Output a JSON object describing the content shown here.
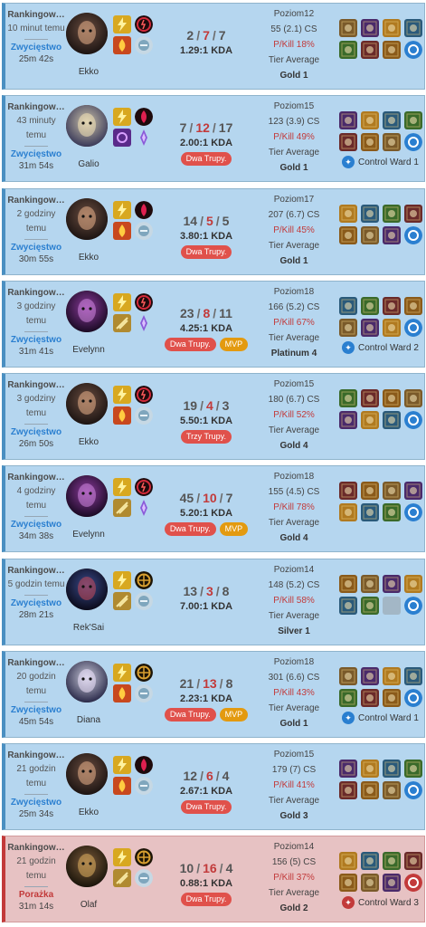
{
  "labels": {
    "queue": "Rankingow…",
    "level_prefix": "Poziom",
    "cs_suffix": "CS",
    "pkill_prefix": "P/Kill",
    "tier_label": "Tier Average",
    "kda_suffix": "KDA"
  },
  "colors": {
    "win_bg": "#b5d6ef",
    "loss_bg": "#e7c2c3",
    "win_text": "#2a7fd0",
    "loss_text": "#c23a3a",
    "deaths": "#c23a3a",
    "multikill_badge": "#e0514b",
    "mvp_badge": "#e39a10"
  },
  "matches": [
    {
      "result": "win",
      "queue": "Rankingow…",
      "time_ago": "10 minut temu",
      "result_label": "Zwycięstwo",
      "duration": "25m 42s",
      "champion": "Ekko",
      "champion_icon": "ekko-portrait",
      "spells": [
        "flash-icon",
        "ignite-icon"
      ],
      "runes": [
        "electrocute-icon",
        "resolve-icon"
      ],
      "kills": "2",
      "deaths": "7",
      "assists": "7",
      "kda": "1.29:1 KDA",
      "badges": [],
      "level": "Poziom12",
      "cs": "55 (2.1) CS",
      "pkill": "P/Kill 18%",
      "tier": "Gold 1",
      "items": [
        "item-a",
        "item-b",
        "item-c",
        "item-d",
        "item-e",
        "item-f",
        "item-g",
        "ward-totem"
      ],
      "control_ward": ""
    },
    {
      "result": "win",
      "queue": "Rankingow…",
      "time_ago": "43 minuty temu",
      "result_label": "Zwycięstwo",
      "duration": "31m 54s",
      "champion": "Galio",
      "champion_icon": "galio-portrait",
      "spells": [
        "flash-icon",
        "teleport-icon"
      ],
      "runes": [
        "conqueror-icon",
        "sorcery-icon"
      ],
      "kills": "7",
      "deaths": "12",
      "assists": "17",
      "kda": "2.00:1 KDA",
      "badges": [
        "Dwa Trupy."
      ],
      "level": "Poziom15",
      "cs": "123 (3.9) CS",
      "pkill": "P/Kill 49%",
      "tier": "Gold 1",
      "items": [
        "item-a",
        "item-b",
        "item-c",
        "item-d",
        "item-e",
        "item-f",
        "item-g",
        "ward-totem"
      ],
      "control_ward": "Control Ward 1"
    },
    {
      "result": "win",
      "queue": "Rankingow…",
      "time_ago": "2 godziny temu",
      "result_label": "Zwycięstwo",
      "duration": "30m 55s",
      "champion": "Ekko",
      "champion_icon": "ekko-portrait",
      "spells": [
        "flash-icon",
        "ignite-icon"
      ],
      "runes": [
        "conqueror-icon",
        "resolve-icon"
      ],
      "kills": "14",
      "deaths": "5",
      "assists": "5",
      "kda": "3.80:1 KDA",
      "badges": [
        "Dwa Trupy."
      ],
      "level": "Poziom17",
      "cs": "207 (6.7) CS",
      "pkill": "P/Kill 45%",
      "tier": "Gold 1",
      "items": [
        "item-a",
        "item-b",
        "item-c",
        "item-d",
        "item-e",
        "item-f",
        "item-g",
        "ward-totem"
      ],
      "control_ward": ""
    },
    {
      "result": "win",
      "queue": "Rankingow…",
      "time_ago": "3 godziny temu",
      "result_label": "Zwycięstwo",
      "duration": "31m 41s",
      "champion": "Evelynn",
      "champion_icon": "evelynn-portrait",
      "spells": [
        "flash-icon",
        "smite-icon"
      ],
      "runes": [
        "electrocute-icon",
        "sorcery-icon"
      ],
      "kills": "23",
      "deaths": "8",
      "assists": "11",
      "kda": "4.25:1 KDA",
      "badges": [
        "Dwa Trupy.",
        "MVP"
      ],
      "level": "Poziom18",
      "cs": "166 (5.2) CS",
      "pkill": "P/Kill 67%",
      "tier": "Platinum 4",
      "items": [
        "item-a",
        "item-b",
        "item-c",
        "item-d",
        "item-e",
        "item-f",
        "item-g",
        "ward-totem"
      ],
      "control_ward": "Control Ward 2"
    },
    {
      "result": "win",
      "queue": "Rankingow…",
      "time_ago": "3 godziny temu",
      "result_label": "Zwycięstwo",
      "duration": "26m 50s",
      "champion": "Ekko",
      "champion_icon": "ekko-portrait",
      "spells": [
        "flash-icon",
        "ignite-icon"
      ],
      "runes": [
        "electrocute-icon",
        "resolve-icon"
      ],
      "kills": "19",
      "deaths": "4",
      "assists": "3",
      "kda": "5.50:1 KDA",
      "badges": [
        "Trzy Trupy."
      ],
      "level": "Poziom15",
      "cs": "180 (6.7) CS",
      "pkill": "P/Kill 52%",
      "tier": "Gold 4",
      "items": [
        "item-a",
        "item-b",
        "item-c",
        "item-d",
        "item-e",
        "item-f",
        "item-g",
        "ward-totem"
      ],
      "control_ward": ""
    },
    {
      "result": "win",
      "queue": "Rankingow…",
      "time_ago": "4 godziny temu",
      "result_label": "Zwycięstwo",
      "duration": "34m 38s",
      "champion": "Evelynn",
      "champion_icon": "evelynn-portrait",
      "spells": [
        "flash-icon",
        "smite-icon"
      ],
      "runes": [
        "electrocute-icon",
        "sorcery-icon"
      ],
      "kills": "45",
      "deaths": "10",
      "assists": "7",
      "kda": "5.20:1 KDA",
      "badges": [
        "Dwa Trupy.",
        "MVP"
      ],
      "level": "Poziom18",
      "cs": "155 (4.5) CS",
      "pkill": "P/Kill 78%",
      "tier": "Gold 4",
      "items": [
        "item-a",
        "item-b",
        "item-c",
        "item-d",
        "item-e",
        "item-f",
        "item-g",
        "ward-totem"
      ],
      "control_ward": ""
    },
    {
      "result": "win",
      "queue": "Rankingow…",
      "time_ago": "5 godzin temu",
      "result_label": "Zwycięstwo",
      "duration": "28m 21s",
      "champion": "Rek'Sai",
      "champion_icon": "reksai-portrait",
      "spells": [
        "flash-icon",
        "smite-icon"
      ],
      "runes": [
        "precision-icon",
        "resolve-icon"
      ],
      "kills": "13",
      "deaths": "3",
      "assists": "8",
      "kda": "7.00:1 KDA",
      "badges": [],
      "level": "Poziom14",
      "cs": "148 (5.2) CS",
      "pkill": "P/Kill 58%",
      "tier": "Silver 1",
      "items": [
        "item-a",
        "item-b",
        "item-c",
        "item-d",
        "item-e",
        "item-f",
        "empty-slot",
        "ward-totem"
      ],
      "control_ward": ""
    },
    {
      "result": "win",
      "queue": "Rankingow…",
      "time_ago": "20 godzin temu",
      "result_label": "Zwycięstwo",
      "duration": "45m 54s",
      "champion": "Diana",
      "champion_icon": "diana-portrait",
      "spells": [
        "flash-icon",
        "ignite-icon"
      ],
      "runes": [
        "precision-icon",
        "resolve-icon"
      ],
      "kills": "21",
      "deaths": "13",
      "assists": "8",
      "kda": "2.23:1 KDA",
      "badges": [
        "Dwa Trupy.",
        "MVP"
      ],
      "level": "Poziom18",
      "cs": "301 (6.6) CS",
      "pkill": "P/Kill 43%",
      "tier": "Gold 1",
      "items": [
        "item-a",
        "item-b",
        "item-c",
        "item-d",
        "item-e",
        "item-f",
        "item-g",
        "ward-totem"
      ],
      "control_ward": "Control Ward 1"
    },
    {
      "result": "win",
      "queue": "Rankingow…",
      "time_ago": "21 godzin temu",
      "result_label": "Zwycięstwo",
      "duration": "25m 34s",
      "champion": "Ekko",
      "champion_icon": "ekko-portrait",
      "spells": [
        "flash-icon",
        "ignite-icon"
      ],
      "runes": [
        "conqueror-icon",
        "resolve-icon"
      ],
      "kills": "12",
      "deaths": "6",
      "assists": "4",
      "kda": "2.67:1 KDA",
      "badges": [
        "Dwa Trupy."
      ],
      "level": "Poziom15",
      "cs": "179 (7) CS",
      "pkill": "P/Kill 41%",
      "tier": "Gold 3",
      "items": [
        "item-a",
        "item-b",
        "item-c",
        "item-d",
        "item-e",
        "item-f",
        "item-g",
        "ward-totem"
      ],
      "control_ward": ""
    },
    {
      "result": "loss",
      "queue": "Rankingow…",
      "time_ago": "21 godzin temu",
      "result_label": "Porażka",
      "duration": "31m 14s",
      "champion": "Olaf",
      "champion_icon": "olaf-portrait",
      "spells": [
        "flash-icon",
        "smite-icon"
      ],
      "runes": [
        "precision-icon",
        "resolve-icon"
      ],
      "kills": "10",
      "deaths": "16",
      "assists": "4",
      "kda": "0.88:1 KDA",
      "badges": [
        "Dwa Trupy."
      ],
      "level": "Poziom14",
      "cs": "156 (5) CS",
      "pkill": "P/Kill 37%",
      "tier": "Gold 2",
      "items": [
        "item-a",
        "item-b",
        "item-c",
        "item-d",
        "item-e",
        "item-f",
        "item-g",
        "ward-sweeper"
      ],
      "control_ward": "Control Ward 3"
    }
  ]
}
